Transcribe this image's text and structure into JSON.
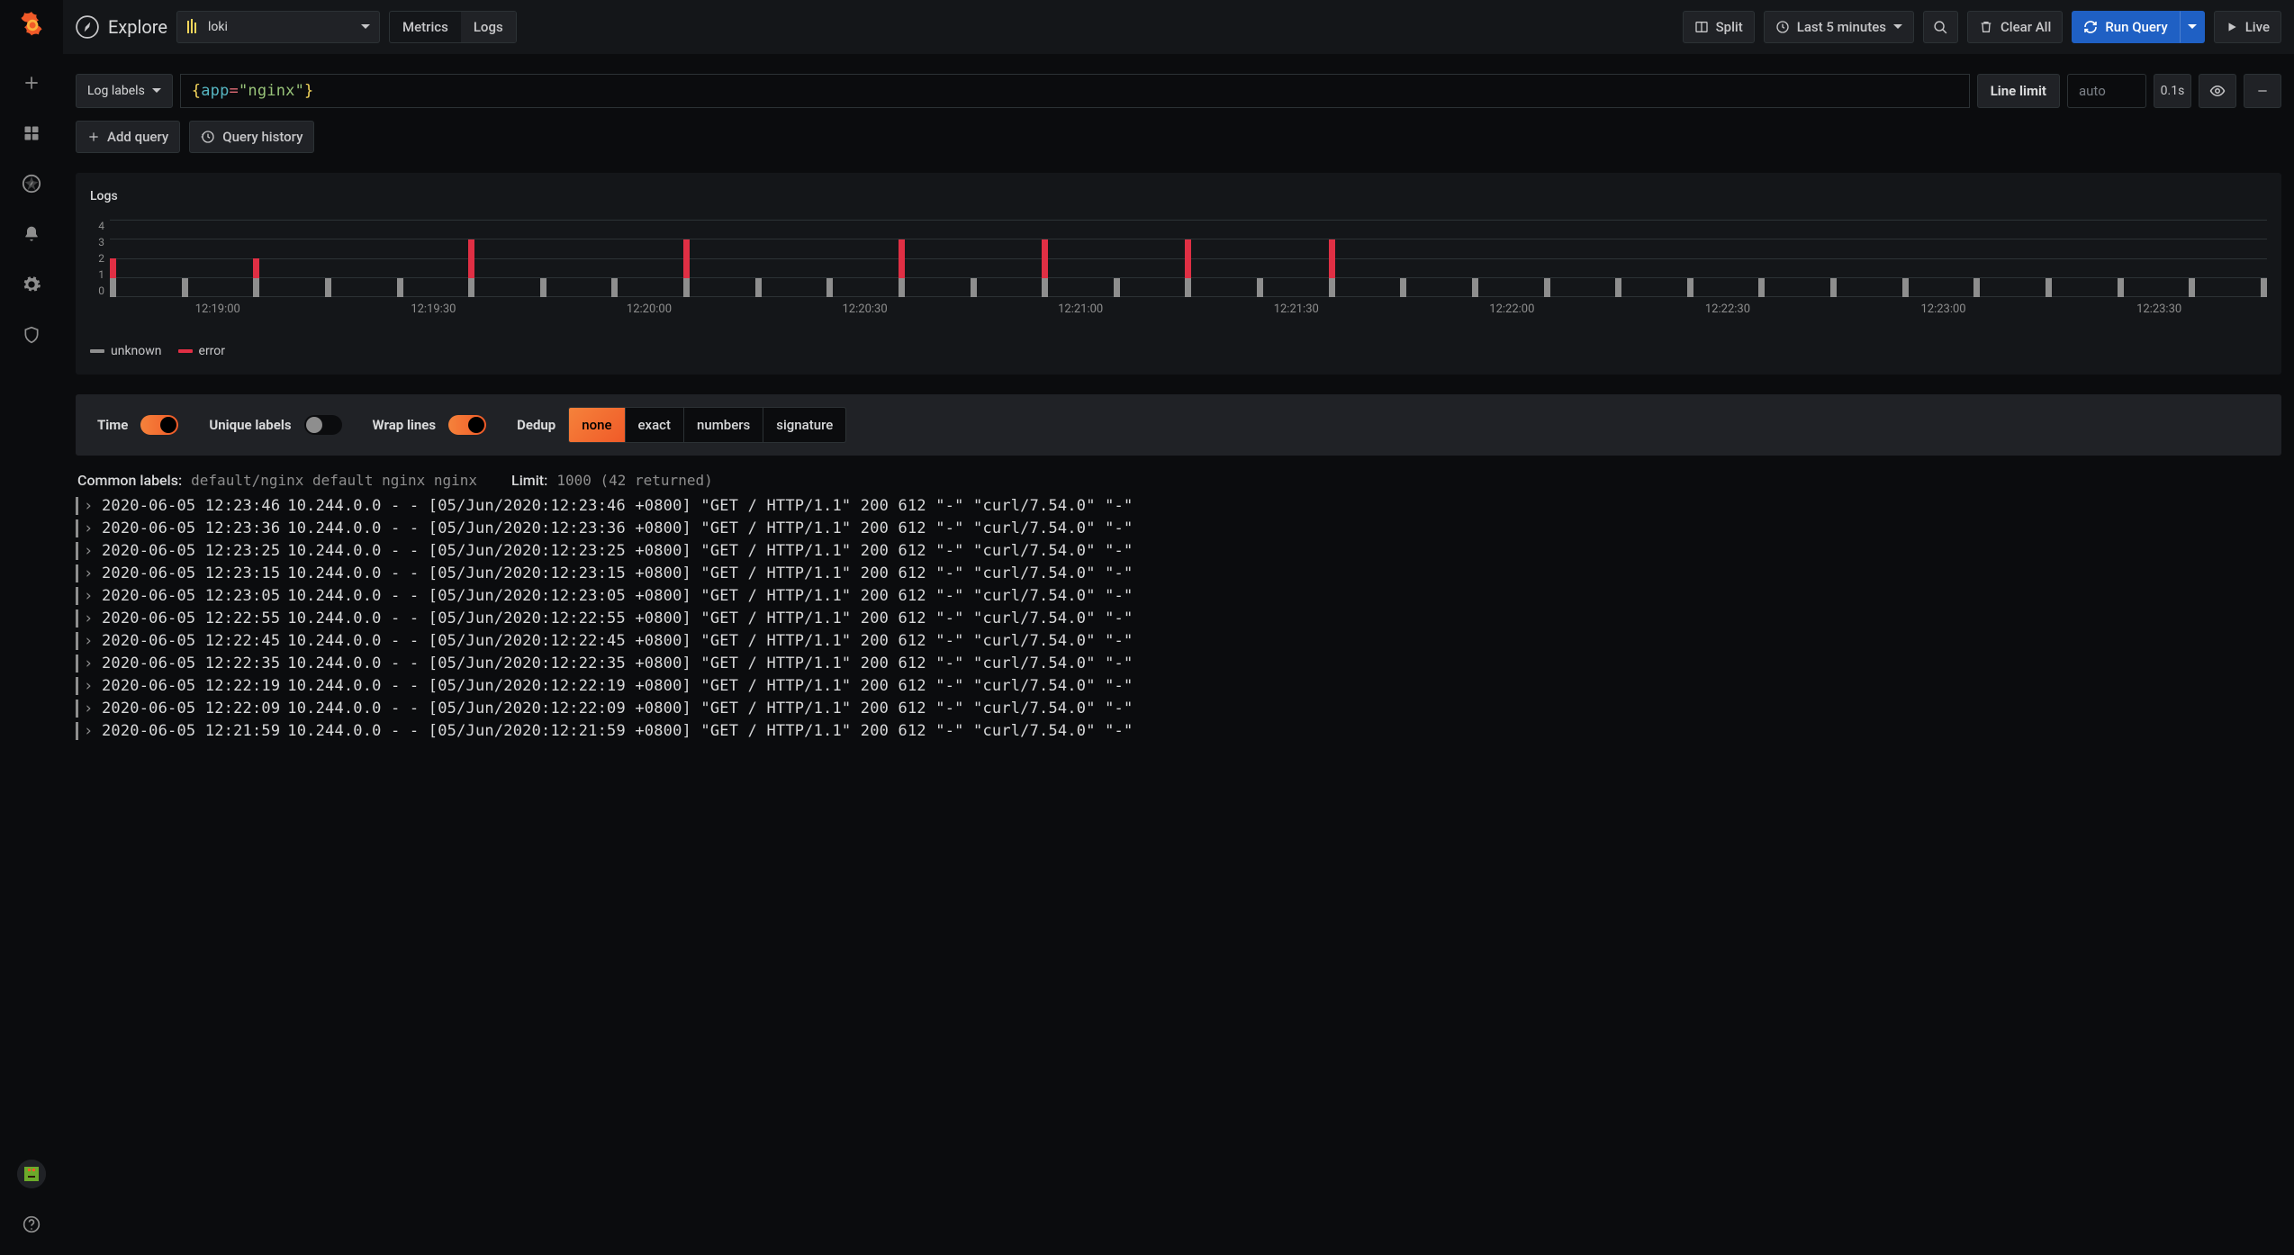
{
  "app": {
    "title": "Explore"
  },
  "datasource": {
    "selected": "loki"
  },
  "query_modes": {
    "metrics": "Metrics",
    "logs": "Logs",
    "active": "logs"
  },
  "toolbar": {
    "split": "Split",
    "time_range": "Last 5 minutes",
    "clear_all": "Clear All",
    "run_query": "Run Query",
    "live": "Live"
  },
  "query_row": {
    "log_labels_btn": "Log labels",
    "expr_parts": {
      "open": "{",
      "key": "app",
      "eq": "=",
      "quote": "\"",
      "val": "nginx",
      "close": "}"
    },
    "line_limit_label": "Line limit",
    "line_limit_placeholder": "auto",
    "timing": "0.1s"
  },
  "query_actions": {
    "add_query": "Add query",
    "query_history": "Query history"
  },
  "panel": {
    "title": "Logs"
  },
  "chart_data": {
    "type": "bar",
    "xlabel": "",
    "ylabel": "",
    "ylim": [
      0,
      4
    ],
    "yticks": [
      4,
      3,
      2,
      1,
      0
    ],
    "xticks": [
      "12:19:00",
      "12:19:30",
      "12:20:00",
      "12:20:30",
      "12:21:00",
      "12:21:30",
      "12:22:00",
      "12:22:30",
      "12:23:00",
      "12:23:30"
    ],
    "series": [
      {
        "name": "unknown",
        "color": "#8e8e8e"
      },
      {
        "name": "error",
        "color": "#e02f44"
      }
    ],
    "columns": [
      {
        "unknown": 1,
        "error": 1
      },
      {
        "unknown": 1,
        "error": 0
      },
      {
        "unknown": 1,
        "error": 1
      },
      {
        "unknown": 1,
        "error": 0
      },
      {
        "unknown": 1,
        "error": 0
      },
      {
        "unknown": 1,
        "error": 2
      },
      {
        "unknown": 1,
        "error": 0
      },
      {
        "unknown": 1,
        "error": 0
      },
      {
        "unknown": 1,
        "error": 2
      },
      {
        "unknown": 1,
        "error": 0
      },
      {
        "unknown": 1,
        "error": 0
      },
      {
        "unknown": 1,
        "error": 2
      },
      {
        "unknown": 1,
        "error": 0
      },
      {
        "unknown": 1,
        "error": 2
      },
      {
        "unknown": 1,
        "error": 0
      },
      {
        "unknown": 1,
        "error": 2
      },
      {
        "unknown": 1,
        "error": 0
      },
      {
        "unknown": 1,
        "error": 2
      },
      {
        "unknown": 1,
        "error": 0
      },
      {
        "unknown": 1,
        "error": 0
      },
      {
        "unknown": 1,
        "error": 0
      },
      {
        "unknown": 1,
        "error": 0
      },
      {
        "unknown": 1,
        "error": 0
      },
      {
        "unknown": 1,
        "error": 0
      },
      {
        "unknown": 1,
        "error": 0
      },
      {
        "unknown": 1,
        "error": 0
      },
      {
        "unknown": 1,
        "error": 0
      },
      {
        "unknown": 1,
        "error": 0
      },
      {
        "unknown": 1,
        "error": 0
      },
      {
        "unknown": 1,
        "error": 0
      },
      {
        "unknown": 1,
        "error": 0
      }
    ]
  },
  "legend": [
    "unknown",
    "error"
  ],
  "options": {
    "time_label": "Time",
    "time_on": true,
    "unique_label": "Unique labels",
    "unique_on": false,
    "wrap_label": "Wrap lines",
    "wrap_on": true,
    "dedup_label": "Dedup",
    "dedup_opts": [
      "none",
      "exact",
      "numbers",
      "signature"
    ],
    "dedup_active": "none"
  },
  "meta": {
    "common_labels_label": "Common labels:",
    "common_labels": "default/nginx default nginx nginx",
    "limit_label": "Limit:",
    "limit_value": "1000 (42 returned)"
  },
  "logs": [
    {
      "ts": "2020-06-05 12:23:46",
      "msg": "10.244.0.0 - - [05/Jun/2020:12:23:46 +0800] \"GET / HTTP/1.1\" 200 612 \"-\" \"curl/7.54.0\" \"-\""
    },
    {
      "ts": "2020-06-05 12:23:36",
      "msg": "10.244.0.0 - - [05/Jun/2020:12:23:36 +0800] \"GET / HTTP/1.1\" 200 612 \"-\" \"curl/7.54.0\" \"-\""
    },
    {
      "ts": "2020-06-05 12:23:25",
      "msg": "10.244.0.0 - - [05/Jun/2020:12:23:25 +0800] \"GET / HTTP/1.1\" 200 612 \"-\" \"curl/7.54.0\" \"-\""
    },
    {
      "ts": "2020-06-05 12:23:15",
      "msg": "10.244.0.0 - - [05/Jun/2020:12:23:15 +0800] \"GET / HTTP/1.1\" 200 612 \"-\" \"curl/7.54.0\" \"-\""
    },
    {
      "ts": "2020-06-05 12:23:05",
      "msg": "10.244.0.0 - - [05/Jun/2020:12:23:05 +0800] \"GET / HTTP/1.1\" 200 612 \"-\" \"curl/7.54.0\" \"-\""
    },
    {
      "ts": "2020-06-05 12:22:55",
      "msg": "10.244.0.0 - - [05/Jun/2020:12:22:55 +0800] \"GET / HTTP/1.1\" 200 612 \"-\" \"curl/7.54.0\" \"-\""
    },
    {
      "ts": "2020-06-05 12:22:45",
      "msg": "10.244.0.0 - - [05/Jun/2020:12:22:45 +0800] \"GET / HTTP/1.1\" 200 612 \"-\" \"curl/7.54.0\" \"-\""
    },
    {
      "ts": "2020-06-05 12:22:35",
      "msg": "10.244.0.0 - - [05/Jun/2020:12:22:35 +0800] \"GET / HTTP/1.1\" 200 612 \"-\" \"curl/7.54.0\" \"-\""
    },
    {
      "ts": "2020-06-05 12:22:19",
      "msg": "10.244.0.0 - - [05/Jun/2020:12:22:19 +0800] \"GET / HTTP/1.1\" 200 612 \"-\" \"curl/7.54.0\" \"-\""
    },
    {
      "ts": "2020-06-05 12:22:09",
      "msg": "10.244.0.0 - - [05/Jun/2020:12:22:09 +0800] \"GET / HTTP/1.1\" 200 612 \"-\" \"curl/7.54.0\" \"-\""
    },
    {
      "ts": "2020-06-05 12:21:59",
      "msg": "10.244.0.0 - - [05/Jun/2020:12:21:59 +0800] \"GET / HTTP/1.1\" 200 612 \"-\" \"curl/7.54.0\" \"-\""
    }
  ]
}
